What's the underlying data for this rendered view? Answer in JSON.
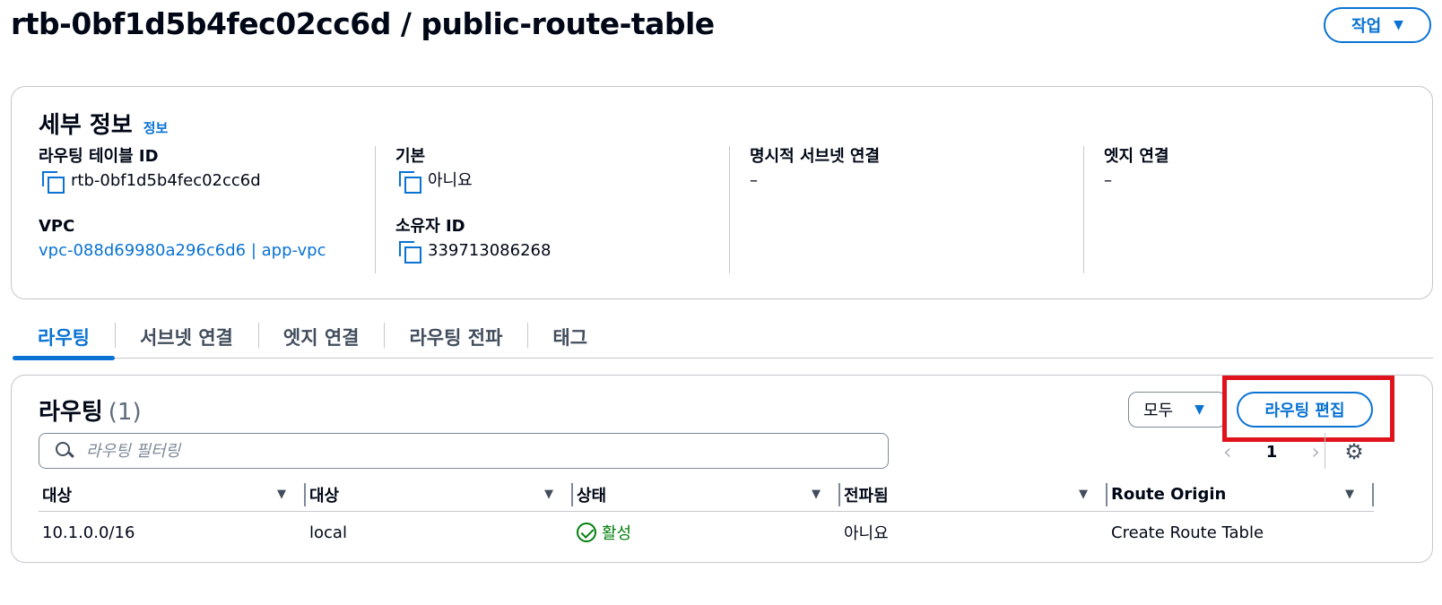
{
  "header": {
    "title": "rtb-0bf1d5b4fec02cc6d / public-route-table",
    "actions_label": "작업"
  },
  "details": {
    "title": "세부 정보",
    "info_link": "정보",
    "route_table_id_label": "라우팅 테이블 ID",
    "route_table_id_value": "rtb-0bf1d5b4fec02cc6d",
    "vpc_label": "VPC",
    "vpc_value": "vpc-088d69980a296c6d6 | app-vpc",
    "main_label": "기본",
    "main_value": "아니요",
    "owner_id_label": "소유자 ID",
    "owner_id_value": "339713086268",
    "explicit_subnet_label": "명시적 서브넷 연결",
    "explicit_subnet_value": "–",
    "edge_label": "엣지 연결",
    "edge_value": "–"
  },
  "tabs": [
    {
      "label": "라우팅",
      "active": true
    },
    {
      "label": "서브넷 연결",
      "active": false
    },
    {
      "label": "엣지 연결",
      "active": false
    },
    {
      "label": "라우팅 전파",
      "active": false
    },
    {
      "label": "태그",
      "active": false
    }
  ],
  "routes": {
    "title": "라우팅",
    "count": "(1)",
    "filter_select": "모두",
    "edit_button": "라우팅 편집",
    "search_placeholder": "라우팅 필터링",
    "page": "1",
    "columns": [
      "대상",
      "대상",
      "상태",
      "전파됨",
      "Route Origin"
    ],
    "rows": [
      {
        "destination": "10.1.0.0/16",
        "target": "local",
        "status": "활성",
        "propagated": "아니요",
        "origin": "Create Route Table"
      }
    ]
  },
  "colors": {
    "accent": "#0972d3",
    "success": "#037f0c",
    "highlight": "#e0121b"
  }
}
